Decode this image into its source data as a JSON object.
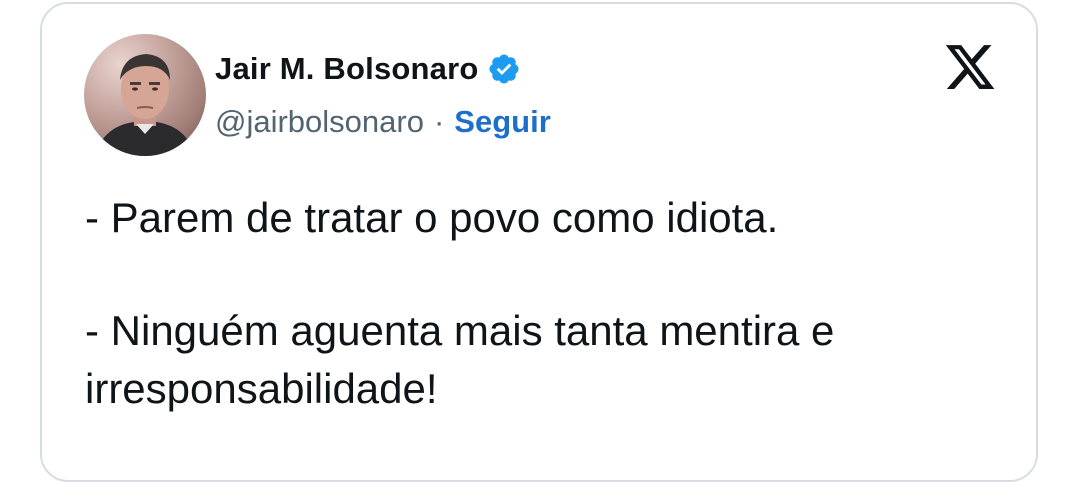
{
  "author": {
    "display_name": "Jair M. Bolsonaro",
    "handle": "@jairbolsonaro",
    "separator": "·",
    "follow_label": "Seguir",
    "verified_color": "#1d9bf0"
  },
  "tweet": {
    "line1": "- Parem de tratar o povo como idiota.",
    "line2": "- Ninguém aguenta mais tanta mentira e",
    "line3": "irresponsabilidade!"
  },
  "icons": {
    "platform_logo": "x-logo-icon",
    "verified_badge": "verified-badge-icon"
  }
}
